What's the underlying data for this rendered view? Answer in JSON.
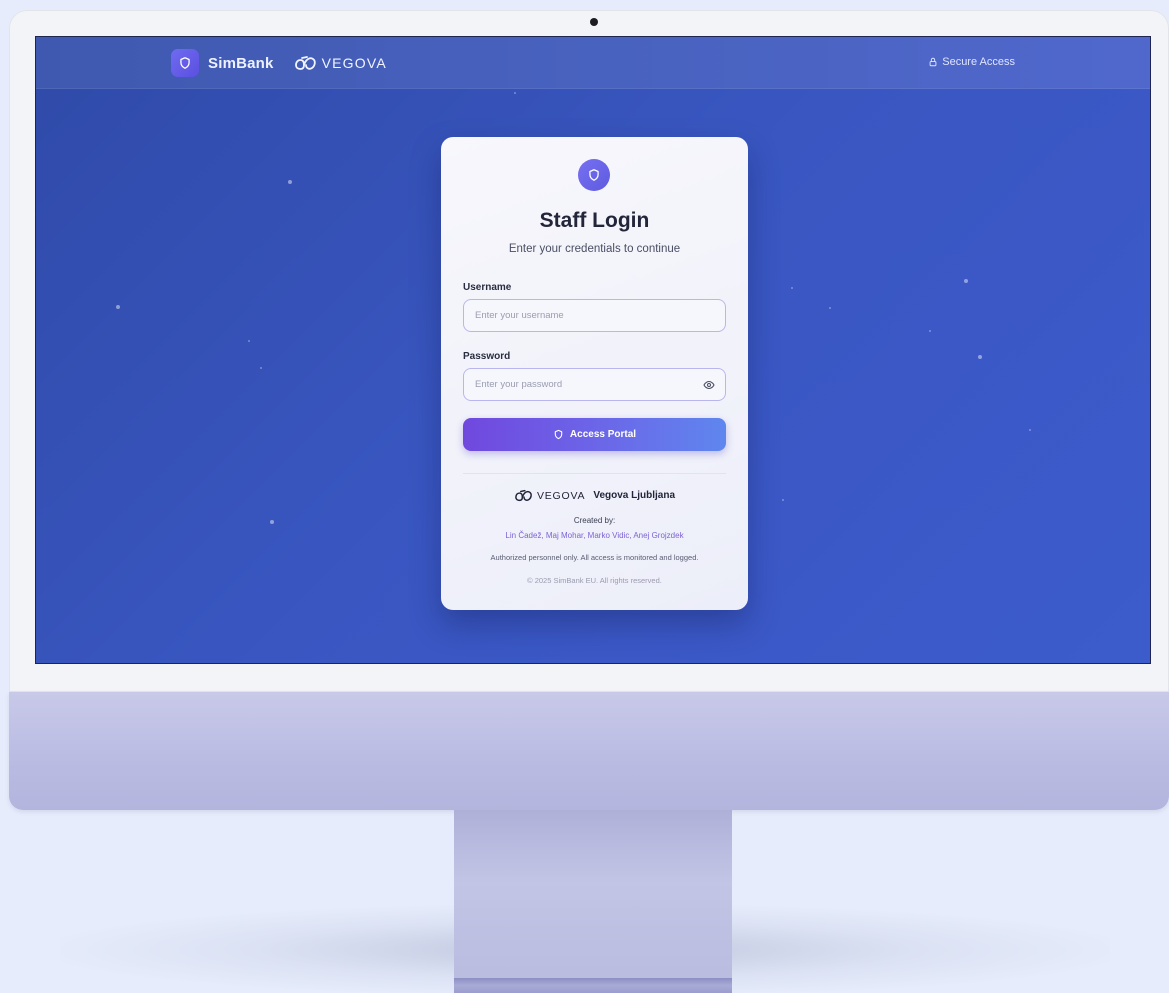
{
  "header": {
    "brand_name": "SimBank",
    "partner_name": "VEGOVA",
    "secure_label": "Secure Access"
  },
  "login": {
    "title": "Staff Login",
    "subtitle": "Enter your credentials to continue",
    "username_label": "Username",
    "username_placeholder": "Enter your username",
    "password_label": "Password",
    "password_placeholder": "Enter your password",
    "submit_label": "Access Portal"
  },
  "footer": {
    "partner_logo_text": "VEGOVA",
    "school_name": "Vegova Ljubljana",
    "created_by_label": "Created by:",
    "authors": "Lin Čadež, Maj Mohar, Marko Vidic, Anej Grojzdek",
    "notice": "Authorized personnel only. All access is monitored and logged.",
    "copyright": "© 2025 SimBank EU. All rights reserved."
  },
  "icons": {
    "brand": "shield-icon",
    "secure": "lock-icon",
    "card": "shield-icon",
    "password_toggle": "eye-icon",
    "submit": "shield-icon",
    "partner": "vegova-logo-icon"
  },
  "colors": {
    "screen_background": "#3552b5",
    "card_background": "#f3f4fb",
    "accent": "#6c5ce7",
    "button_gradient_start": "#7048de",
    "button_gradient_end": "#5f86ee",
    "authors_link": "#7d63d6"
  }
}
